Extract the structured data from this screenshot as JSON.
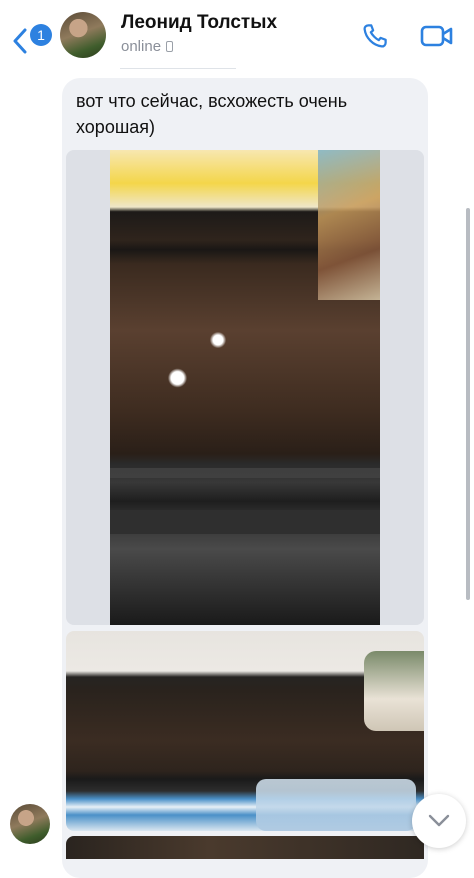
{
  "header": {
    "back_badge": "1",
    "contact_name": "Леонид Толстых",
    "status": "online"
  },
  "message": {
    "text": "вот что сейчас, всхожесть очень хорошая)"
  },
  "colors": {
    "accent": "#2d81e0",
    "bubble": "#eff1f5",
    "status": "#8a8f99"
  },
  "icons": {
    "back": "chevron-left-icon",
    "call": "phone-icon",
    "video": "video-camera-icon",
    "scroll": "chevron-down-icon"
  }
}
